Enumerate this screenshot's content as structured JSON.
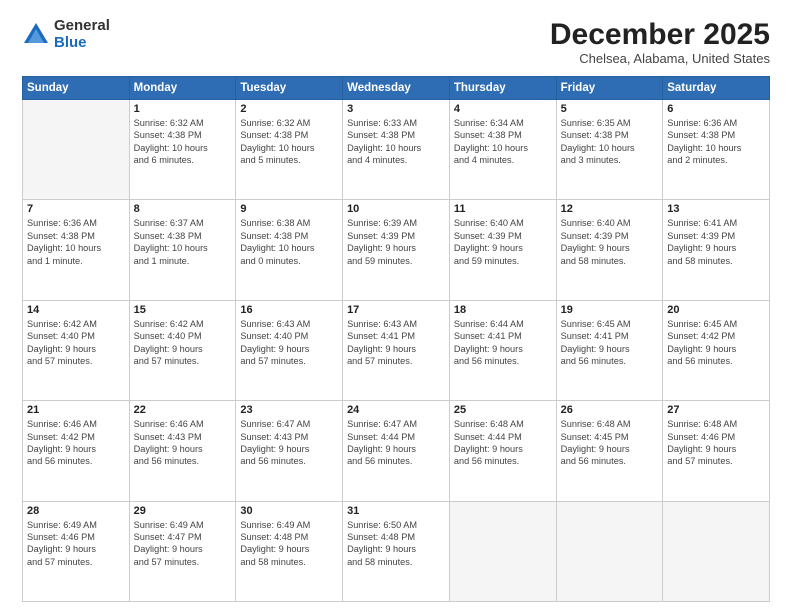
{
  "logo": {
    "general": "General",
    "blue": "Blue"
  },
  "title": "December 2025",
  "location": "Chelsea, Alabama, United States",
  "weekdays": [
    "Sunday",
    "Monday",
    "Tuesday",
    "Wednesday",
    "Thursday",
    "Friday",
    "Saturday"
  ],
  "weeks": [
    [
      {
        "day": "",
        "text": ""
      },
      {
        "day": "1",
        "text": "Sunrise: 6:32 AM\nSunset: 4:38 PM\nDaylight: 10 hours\nand 6 minutes."
      },
      {
        "day": "2",
        "text": "Sunrise: 6:32 AM\nSunset: 4:38 PM\nDaylight: 10 hours\nand 5 minutes."
      },
      {
        "day": "3",
        "text": "Sunrise: 6:33 AM\nSunset: 4:38 PM\nDaylight: 10 hours\nand 4 minutes."
      },
      {
        "day": "4",
        "text": "Sunrise: 6:34 AM\nSunset: 4:38 PM\nDaylight: 10 hours\nand 4 minutes."
      },
      {
        "day": "5",
        "text": "Sunrise: 6:35 AM\nSunset: 4:38 PM\nDaylight: 10 hours\nand 3 minutes."
      },
      {
        "day": "6",
        "text": "Sunrise: 6:36 AM\nSunset: 4:38 PM\nDaylight: 10 hours\nand 2 minutes."
      }
    ],
    [
      {
        "day": "7",
        "text": "Sunrise: 6:36 AM\nSunset: 4:38 PM\nDaylight: 10 hours\nand 1 minute."
      },
      {
        "day": "8",
        "text": "Sunrise: 6:37 AM\nSunset: 4:38 PM\nDaylight: 10 hours\nand 1 minute."
      },
      {
        "day": "9",
        "text": "Sunrise: 6:38 AM\nSunset: 4:38 PM\nDaylight: 10 hours\nand 0 minutes."
      },
      {
        "day": "10",
        "text": "Sunrise: 6:39 AM\nSunset: 4:39 PM\nDaylight: 9 hours\nand 59 minutes."
      },
      {
        "day": "11",
        "text": "Sunrise: 6:40 AM\nSunset: 4:39 PM\nDaylight: 9 hours\nand 59 minutes."
      },
      {
        "day": "12",
        "text": "Sunrise: 6:40 AM\nSunset: 4:39 PM\nDaylight: 9 hours\nand 58 minutes."
      },
      {
        "day": "13",
        "text": "Sunrise: 6:41 AM\nSunset: 4:39 PM\nDaylight: 9 hours\nand 58 minutes."
      }
    ],
    [
      {
        "day": "14",
        "text": "Sunrise: 6:42 AM\nSunset: 4:40 PM\nDaylight: 9 hours\nand 57 minutes."
      },
      {
        "day": "15",
        "text": "Sunrise: 6:42 AM\nSunset: 4:40 PM\nDaylight: 9 hours\nand 57 minutes."
      },
      {
        "day": "16",
        "text": "Sunrise: 6:43 AM\nSunset: 4:40 PM\nDaylight: 9 hours\nand 57 minutes."
      },
      {
        "day": "17",
        "text": "Sunrise: 6:43 AM\nSunset: 4:41 PM\nDaylight: 9 hours\nand 57 minutes."
      },
      {
        "day": "18",
        "text": "Sunrise: 6:44 AM\nSunset: 4:41 PM\nDaylight: 9 hours\nand 56 minutes."
      },
      {
        "day": "19",
        "text": "Sunrise: 6:45 AM\nSunset: 4:41 PM\nDaylight: 9 hours\nand 56 minutes."
      },
      {
        "day": "20",
        "text": "Sunrise: 6:45 AM\nSunset: 4:42 PM\nDaylight: 9 hours\nand 56 minutes."
      }
    ],
    [
      {
        "day": "21",
        "text": "Sunrise: 6:46 AM\nSunset: 4:42 PM\nDaylight: 9 hours\nand 56 minutes."
      },
      {
        "day": "22",
        "text": "Sunrise: 6:46 AM\nSunset: 4:43 PM\nDaylight: 9 hours\nand 56 minutes."
      },
      {
        "day": "23",
        "text": "Sunrise: 6:47 AM\nSunset: 4:43 PM\nDaylight: 9 hours\nand 56 minutes."
      },
      {
        "day": "24",
        "text": "Sunrise: 6:47 AM\nSunset: 4:44 PM\nDaylight: 9 hours\nand 56 minutes."
      },
      {
        "day": "25",
        "text": "Sunrise: 6:48 AM\nSunset: 4:44 PM\nDaylight: 9 hours\nand 56 minutes."
      },
      {
        "day": "26",
        "text": "Sunrise: 6:48 AM\nSunset: 4:45 PM\nDaylight: 9 hours\nand 56 minutes."
      },
      {
        "day": "27",
        "text": "Sunrise: 6:48 AM\nSunset: 4:46 PM\nDaylight: 9 hours\nand 57 minutes."
      }
    ],
    [
      {
        "day": "28",
        "text": "Sunrise: 6:49 AM\nSunset: 4:46 PM\nDaylight: 9 hours\nand 57 minutes."
      },
      {
        "day": "29",
        "text": "Sunrise: 6:49 AM\nSunset: 4:47 PM\nDaylight: 9 hours\nand 57 minutes."
      },
      {
        "day": "30",
        "text": "Sunrise: 6:49 AM\nSunset: 4:48 PM\nDaylight: 9 hours\nand 58 minutes."
      },
      {
        "day": "31",
        "text": "Sunrise: 6:50 AM\nSunset: 4:48 PM\nDaylight: 9 hours\nand 58 minutes."
      },
      {
        "day": "",
        "text": ""
      },
      {
        "day": "",
        "text": ""
      },
      {
        "day": "",
        "text": ""
      }
    ]
  ]
}
